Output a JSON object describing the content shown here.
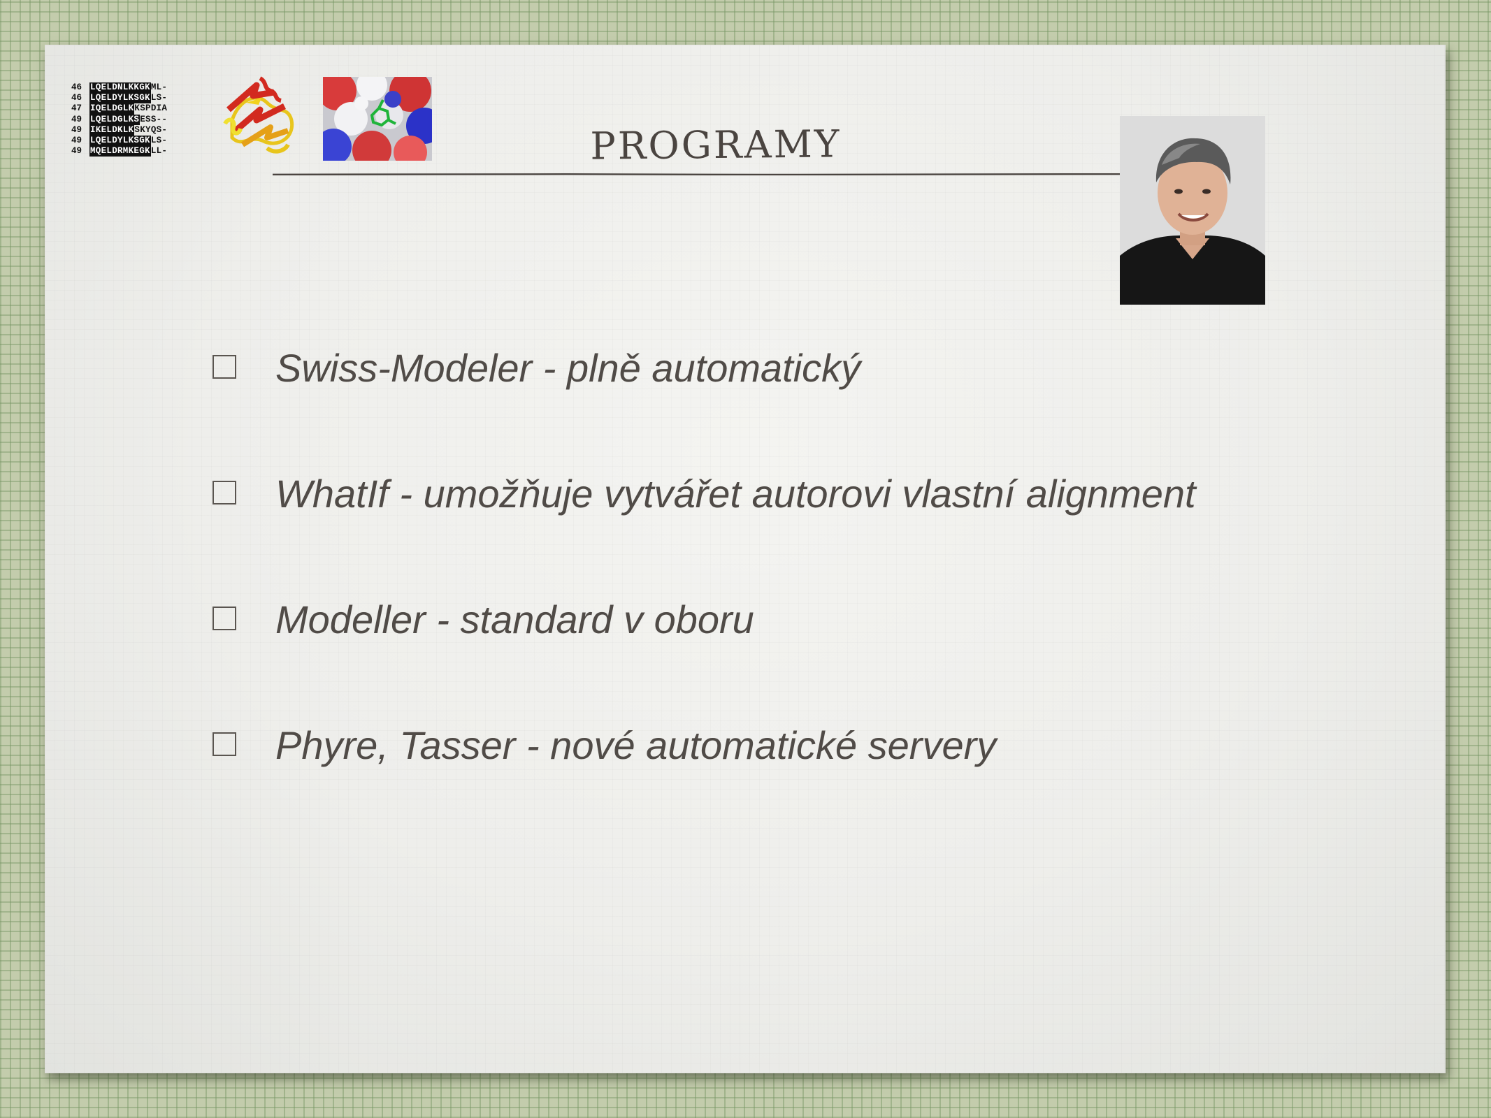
{
  "slide": {
    "title": "PROGRAMY",
    "alignment": {
      "rows": [
        {
          "num": "46",
          "seq": "LQELDNLKKGK",
          "tail": "ML-"
        },
        {
          "num": "46",
          "seq": "LQELDYLKSGK",
          "tail": "LS-"
        },
        {
          "num": "47",
          "seq": "IQELDGLK",
          "tail": "KSPDIA"
        },
        {
          "num": "49",
          "seq": "LQELDGLKS",
          "tail": "ESS--"
        },
        {
          "num": "49",
          "seq": "IKELDKLK",
          "tail": "SKYQS-"
        },
        {
          "num": "49",
          "seq": "LQELDYLKSGK",
          "tail": "LS-"
        },
        {
          "num": "49",
          "seq": "MQELDRMKEGK",
          "tail": "LL-"
        }
      ]
    },
    "bullets": [
      {
        "text": "Swiss-Modeler - plně automatický"
      },
      {
        "text": "WhatIf - umožňuje vytvářet autorovi vlastní alignment"
      },
      {
        "text": "Modeller - standard v oboru"
      },
      {
        "text": "Phyre, Tasser - nové automatické servery"
      }
    ]
  },
  "colors": {
    "background": "#c3ccac",
    "slide": "#efefec",
    "text": "#504b47"
  },
  "icons": {
    "bullet": "empty-square-checkbox-icon"
  }
}
